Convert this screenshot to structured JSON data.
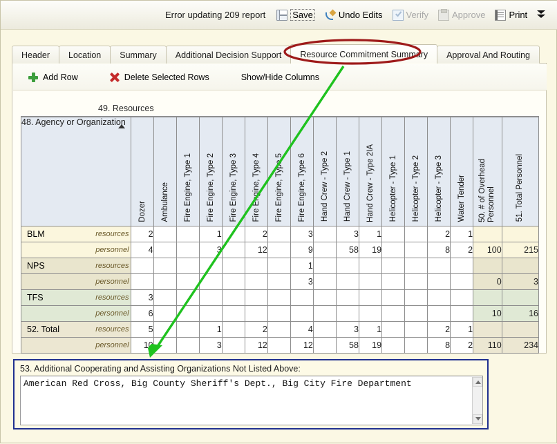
{
  "toolbar": {
    "message": "Error updating 209 report",
    "items": [
      {
        "label": "Save",
        "icon": "save-icon",
        "state": "enabled",
        "focused": true
      },
      {
        "label": "Undo Edits",
        "icon": "undo-icon",
        "state": "enabled",
        "focused": false
      },
      {
        "label": "Verify",
        "icon": "verify-icon",
        "state": "disabled",
        "focused": false
      },
      {
        "label": "Approve",
        "icon": "approve-icon",
        "state": "disabled",
        "focused": false
      },
      {
        "label": "Print",
        "icon": "print-icon",
        "state": "enabled",
        "focused": false
      }
    ],
    "more_icon": "double-chevron-down-icon"
  },
  "tabs": [
    {
      "label": "Header",
      "active": false
    },
    {
      "label": "Location",
      "active": false
    },
    {
      "label": "Summary",
      "active": false
    },
    {
      "label": "Additional Decision Support",
      "active": false
    },
    {
      "label": "Resource Commitment Summary",
      "active": true
    },
    {
      "label": "Approval And Routing",
      "active": false
    }
  ],
  "actions": [
    {
      "id": "add-row",
      "label": "Add Row",
      "icon": "plus-icon"
    },
    {
      "id": "delete-selected-rows",
      "label": "Delete Selected Rows",
      "icon": "x-icon"
    },
    {
      "id": "show-hide-columns",
      "label": "Show/Hide Columns",
      "icon": "none"
    }
  ],
  "grid": {
    "caption": "49. Resources",
    "agency_header": "48. Agency or Organization",
    "sort_indicator": "sort-ascending-caret",
    "columns": [
      "Dozer",
      "Ambulance",
      "Fire Engine, Type 1",
      "Fire Engine, Type 2",
      "Fire Engine, Type 3",
      "Fire Engine, Type 4",
      "Fire Engine, Type 5",
      "Fire Engine, Type 6",
      "Hand Crew - Type 2",
      "Hand Crew - Type 1",
      "Hand Crew - Type 2IA",
      "Helicopter - Type 1",
      "Helicopter - Type 2",
      "Helicopter - Type 3",
      "Water Tender"
    ],
    "summary_columns": [
      "50. # of Overhead Personnel",
      "51. Total Personnel"
    ],
    "sub_labels": {
      "resources": "resources",
      "personnel": "personnel"
    },
    "rows": [
      {
        "agency": "BLM",
        "tint": "r-blm",
        "resources": [
          "2",
          "",
          "",
          "1",
          "",
          "2",
          "",
          "3",
          "",
          "3",
          "1",
          "",
          "",
          "2",
          "1"
        ],
        "personnel": [
          "4",
          "",
          "",
          "3",
          "",
          "12",
          "",
          "9",
          "",
          "58",
          "19",
          "",
          "",
          "8",
          "2"
        ],
        "overhead_resources": "",
        "total_resources": "",
        "overhead_personnel": "100",
        "total_personnel": "215"
      },
      {
        "agency": "NPS",
        "tint": "r-nps",
        "resources": [
          "",
          "",
          "",
          "",
          "",
          "",
          "",
          "1",
          "",
          "",
          "",
          "",
          "",
          "",
          ""
        ],
        "personnel": [
          "",
          "",
          "",
          "",
          "",
          "",
          "",
          "3",
          "",
          "",
          "",
          "",
          "",
          "",
          ""
        ],
        "overhead_resources": "",
        "total_resources": "",
        "overhead_personnel": "0",
        "total_personnel": "3"
      },
      {
        "agency": "TFS",
        "tint": "r-tfs",
        "resources": [
          "3",
          "",
          "",
          "",
          "",
          "",
          "",
          "",
          "",
          "",
          "",
          "",
          "",
          "",
          ""
        ],
        "personnel": [
          "6",
          "",
          "",
          "",
          "",
          "",
          "",
          "",
          "",
          "",
          "",
          "",
          "",
          "",
          ""
        ],
        "overhead_resources": "",
        "total_resources": "",
        "overhead_personnel": "10",
        "total_personnel": "16"
      },
      {
        "agency": "52. Total",
        "tint": "r-tot",
        "resources": [
          "5",
          "",
          "",
          "1",
          "",
          "2",
          "",
          "4",
          "",
          "3",
          "1",
          "",
          "",
          "2",
          "1"
        ],
        "personnel": [
          "10",
          "",
          "",
          "3",
          "",
          "12",
          "",
          "12",
          "",
          "58",
          "19",
          "",
          "",
          "8",
          "2"
        ],
        "overhead_resources": "",
        "total_resources": "",
        "overhead_personnel": "110",
        "total_personnel": "234"
      }
    ]
  },
  "bottom": {
    "label": "53. Additional Cooperating and Assisting Organizations Not Listed Above:",
    "value": "American Red Cross, Big County Sheriff's Dept., Big City Fire Department",
    "scroll_up_icon": "scroll-up-arrow-icon",
    "scroll_down_icon": "scroll-down-arrow-icon"
  },
  "annotations": {
    "ellipse_color": "#9e1a1a",
    "arrow_color": "#1fc21f",
    "highlight_box_color": "#1f2f8f"
  }
}
